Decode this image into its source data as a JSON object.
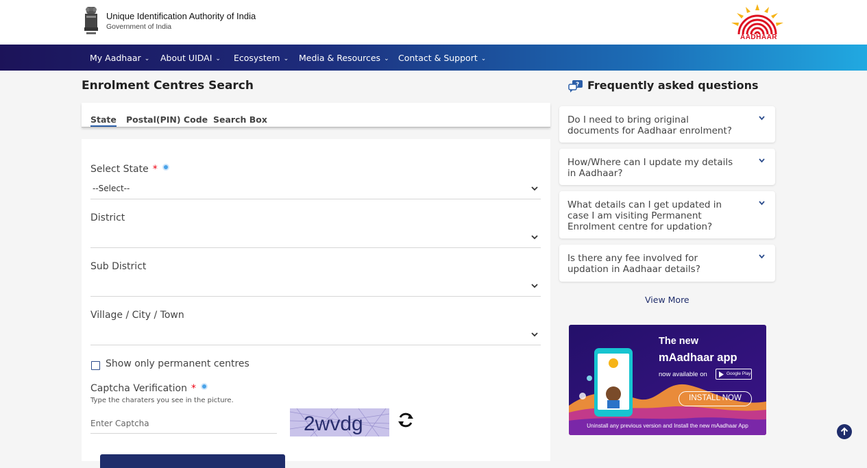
{
  "header": {
    "org_title": "Unique Identification Authority of India",
    "org_subtitle": "Government of India",
    "logo_text": "AADHAAR"
  },
  "nav": {
    "items": [
      {
        "label": "My Aadhaar"
      },
      {
        "label": "About UIDAI"
      },
      {
        "label": "Ecosystem"
      },
      {
        "label": "Media & Resources"
      },
      {
        "label": "Contact & Support"
      }
    ]
  },
  "main": {
    "title": "Enrolment Centres Search",
    "tabs": [
      {
        "label": "State",
        "active": true
      },
      {
        "label": "Postal(PIN) Code",
        "active": false
      },
      {
        "label": "Search Box",
        "active": false
      }
    ],
    "form": {
      "state_label": "Select State",
      "state_required": "*",
      "state_value": "--Select--",
      "district_label": "District",
      "subdistrict_label": "Sub District",
      "village_label": "Village / City / Town",
      "permanent_label": "Show only permanent centres",
      "permanent_checked": false,
      "captcha_label": "Captcha Verification",
      "captcha_required": "*",
      "captcha_hint": "Type the charaters you see in the picture.",
      "captcha_placeholder": "Enter Captcha",
      "captcha_text": "2wvdg"
    }
  },
  "faq": {
    "title": "Frequently asked questions",
    "items": [
      {
        "question": "Do I need to bring original documents for Aadhaar enrolment?"
      },
      {
        "question": "How/Where can I update my details in Aadhaar?"
      },
      {
        "question": "What details can I get updated in case I am visiting Permanent Enrolment centre for updation?"
      },
      {
        "question": "Is there any fee involved for updation in Aadhaar details?"
      }
    ],
    "view_more": "View More"
  },
  "promo": {
    "title_line1": "The new",
    "title_line2": "mAadhaar app",
    "available_text": "now available on",
    "store_text": "Google Play",
    "button_text": "INSTALL NOW",
    "footer_text": "Uninstall any previous version and Install the new mAadhaar App"
  },
  "colors": {
    "nav_start": "#1c1359",
    "nav_end": "#21a9e1",
    "accent_blue": "#2b5ea8",
    "required_red": "#e01",
    "promo_bg": "#2a1270"
  }
}
